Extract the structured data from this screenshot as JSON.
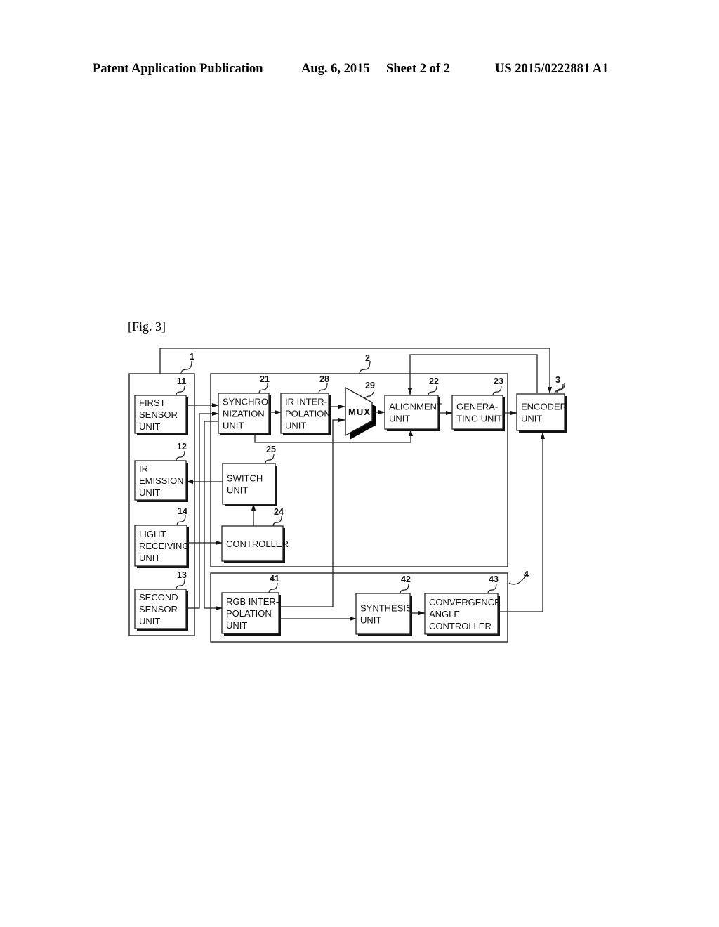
{
  "header": {
    "publication": "Patent Application Publication",
    "date": "Aug. 6, 2015",
    "sheet": "Sheet 2 of 2",
    "number": "US 2015/0222881 A1"
  },
  "figure": {
    "label": "[Fig. 3]",
    "groups": [
      {
        "ref": "1",
        "name": "sensor-group"
      },
      {
        "ref": "2",
        "name": "processing-group"
      },
      {
        "ref": "4",
        "name": "convergence-group"
      }
    ],
    "blocks": {
      "first_sensor": {
        "ref": "11",
        "lines": [
          "FIRST",
          "SENSOR",
          "UNIT"
        ]
      },
      "ir_emission": {
        "ref": "12",
        "lines": [
          "IR",
          "EMISSION",
          "UNIT"
        ]
      },
      "light_receiving": {
        "ref": "14",
        "lines": [
          "LIGHT",
          "RECEIVING",
          "UNIT"
        ]
      },
      "second_sensor": {
        "ref": "13",
        "lines": [
          "SECOND",
          "SENSOR",
          "UNIT"
        ]
      },
      "synchronization": {
        "ref": "21",
        "lines": [
          "SYNCHRO-",
          "NIZATION",
          "UNIT"
        ]
      },
      "ir_interpolation": {
        "ref": "28",
        "lines": [
          "IR INTER-",
          "POLATION",
          "UNIT"
        ]
      },
      "mux": {
        "ref": "29",
        "lines": [
          "MUX"
        ]
      },
      "alignment": {
        "ref": "22",
        "lines": [
          "ALIGNMENT",
          "UNIT"
        ]
      },
      "generating": {
        "ref": "23",
        "lines": [
          "GENERA-",
          "TING UNIT"
        ]
      },
      "encoder": {
        "ref": "3",
        "lines": [
          "ENCODER",
          "UNIT"
        ]
      },
      "switch": {
        "ref": "25",
        "lines": [
          "SWITCH",
          "UNIT"
        ]
      },
      "controller": {
        "ref": "24",
        "lines": [
          "CONTROLLER"
        ]
      },
      "rgb_interpolation": {
        "ref": "41",
        "lines": [
          "RGB INTER-",
          "POLATION",
          "UNIT"
        ]
      },
      "synthesis": {
        "ref": "42",
        "lines": [
          "SYNTHESIS",
          "UNIT"
        ]
      },
      "convergence": {
        "ref": "43",
        "lines": [
          "CONVERGENCE",
          "ANGLE",
          "CONTROLLER"
        ]
      }
    }
  }
}
